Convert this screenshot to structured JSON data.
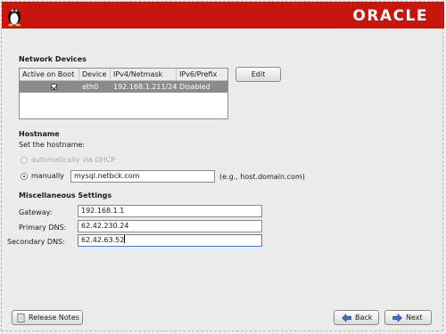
{
  "banner": {
    "brand": "ORACLE",
    "color": "#c8150d"
  },
  "network_devices": {
    "title": "Network Devices",
    "columns": [
      "Active on Boot",
      "Device",
      "IPv4/Netmask",
      "IPv6/Prefix"
    ],
    "rows": [
      {
        "active": true,
        "device": "eth0",
        "ipv4": "192.168.1.211/24",
        "ipv6": "Disabled"
      }
    ],
    "edit_button": "Edit"
  },
  "hostname": {
    "title": "Hostname",
    "prompt": "Set the hostname:",
    "option_dhcp": "automatically via DHCP",
    "option_manual": "manually",
    "manual_value": "mysql.netbck.com",
    "example": "(e.g., host.domain.com)"
  },
  "misc": {
    "title": "Miscellaneous Settings",
    "gateway_label": "Gateway:",
    "gateway_value": "192.168.1.1",
    "primary_dns_label": "Primary DNS:",
    "primary_dns_value": "62.42.230.24",
    "secondary_dns_label": "Secondary DNS:",
    "secondary_dns_value": "62.42.63.52"
  },
  "footer": {
    "release_notes": "Release Notes",
    "back": "Back",
    "next": "Next"
  }
}
